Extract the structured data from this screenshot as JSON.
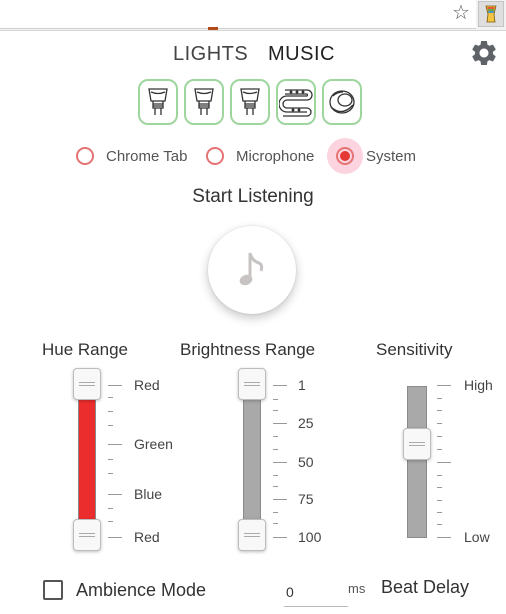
{
  "browser": {
    "star_icon": "star-icon",
    "extension_icon": "extension-icon"
  },
  "tabs": [
    {
      "label": "LIGHTS",
      "active": false
    },
    {
      "label": "MUSIC",
      "active": true
    }
  ],
  "settings_icon": "gear-icon",
  "lights": [
    {
      "type": "bulb-spot",
      "icon": "spot-bulb-icon",
      "selected": true
    },
    {
      "type": "bulb-spot",
      "icon": "spot-bulb-icon",
      "selected": true
    },
    {
      "type": "bulb-spot",
      "icon": "spot-bulb-icon",
      "selected": true
    },
    {
      "type": "lightstrip",
      "icon": "lightstrip-icon",
      "selected": true
    },
    {
      "type": "lamp",
      "icon": "lamp-icon",
      "selected": true
    }
  ],
  "audio_source": {
    "options": [
      {
        "label": "Chrome Tab",
        "selected": false
      },
      {
        "label": "Microphone",
        "selected": false
      },
      {
        "label": "System",
        "selected": true
      }
    ]
  },
  "listen": {
    "title": "Start Listening",
    "icon": "music-note-icon"
  },
  "hue_range": {
    "title": "Hue Range",
    "labels": [
      "Red",
      "Green",
      "Blue",
      "Red"
    ],
    "min_fraction": 0,
    "max_fraction": 1
  },
  "brightness_range": {
    "title": "Brightness Range",
    "labels": [
      "1",
      "25",
      "50",
      "75",
      "100"
    ],
    "min": 1,
    "max": 100
  },
  "sensitivity": {
    "title": "Sensitivity",
    "labels": [
      "High",
      "Low"
    ],
    "value_fraction": 0.4
  },
  "ambience": {
    "label": "Ambience Mode",
    "checked": false
  },
  "beat_delay": {
    "value": "0",
    "unit": "ms",
    "label": "Beat Delay"
  },
  "colors": {
    "accent_red": "#e53935",
    "tile_border": "#9ed69e",
    "hue_fill": "#ec2d2d",
    "track_gray": "#a9a9a9"
  }
}
